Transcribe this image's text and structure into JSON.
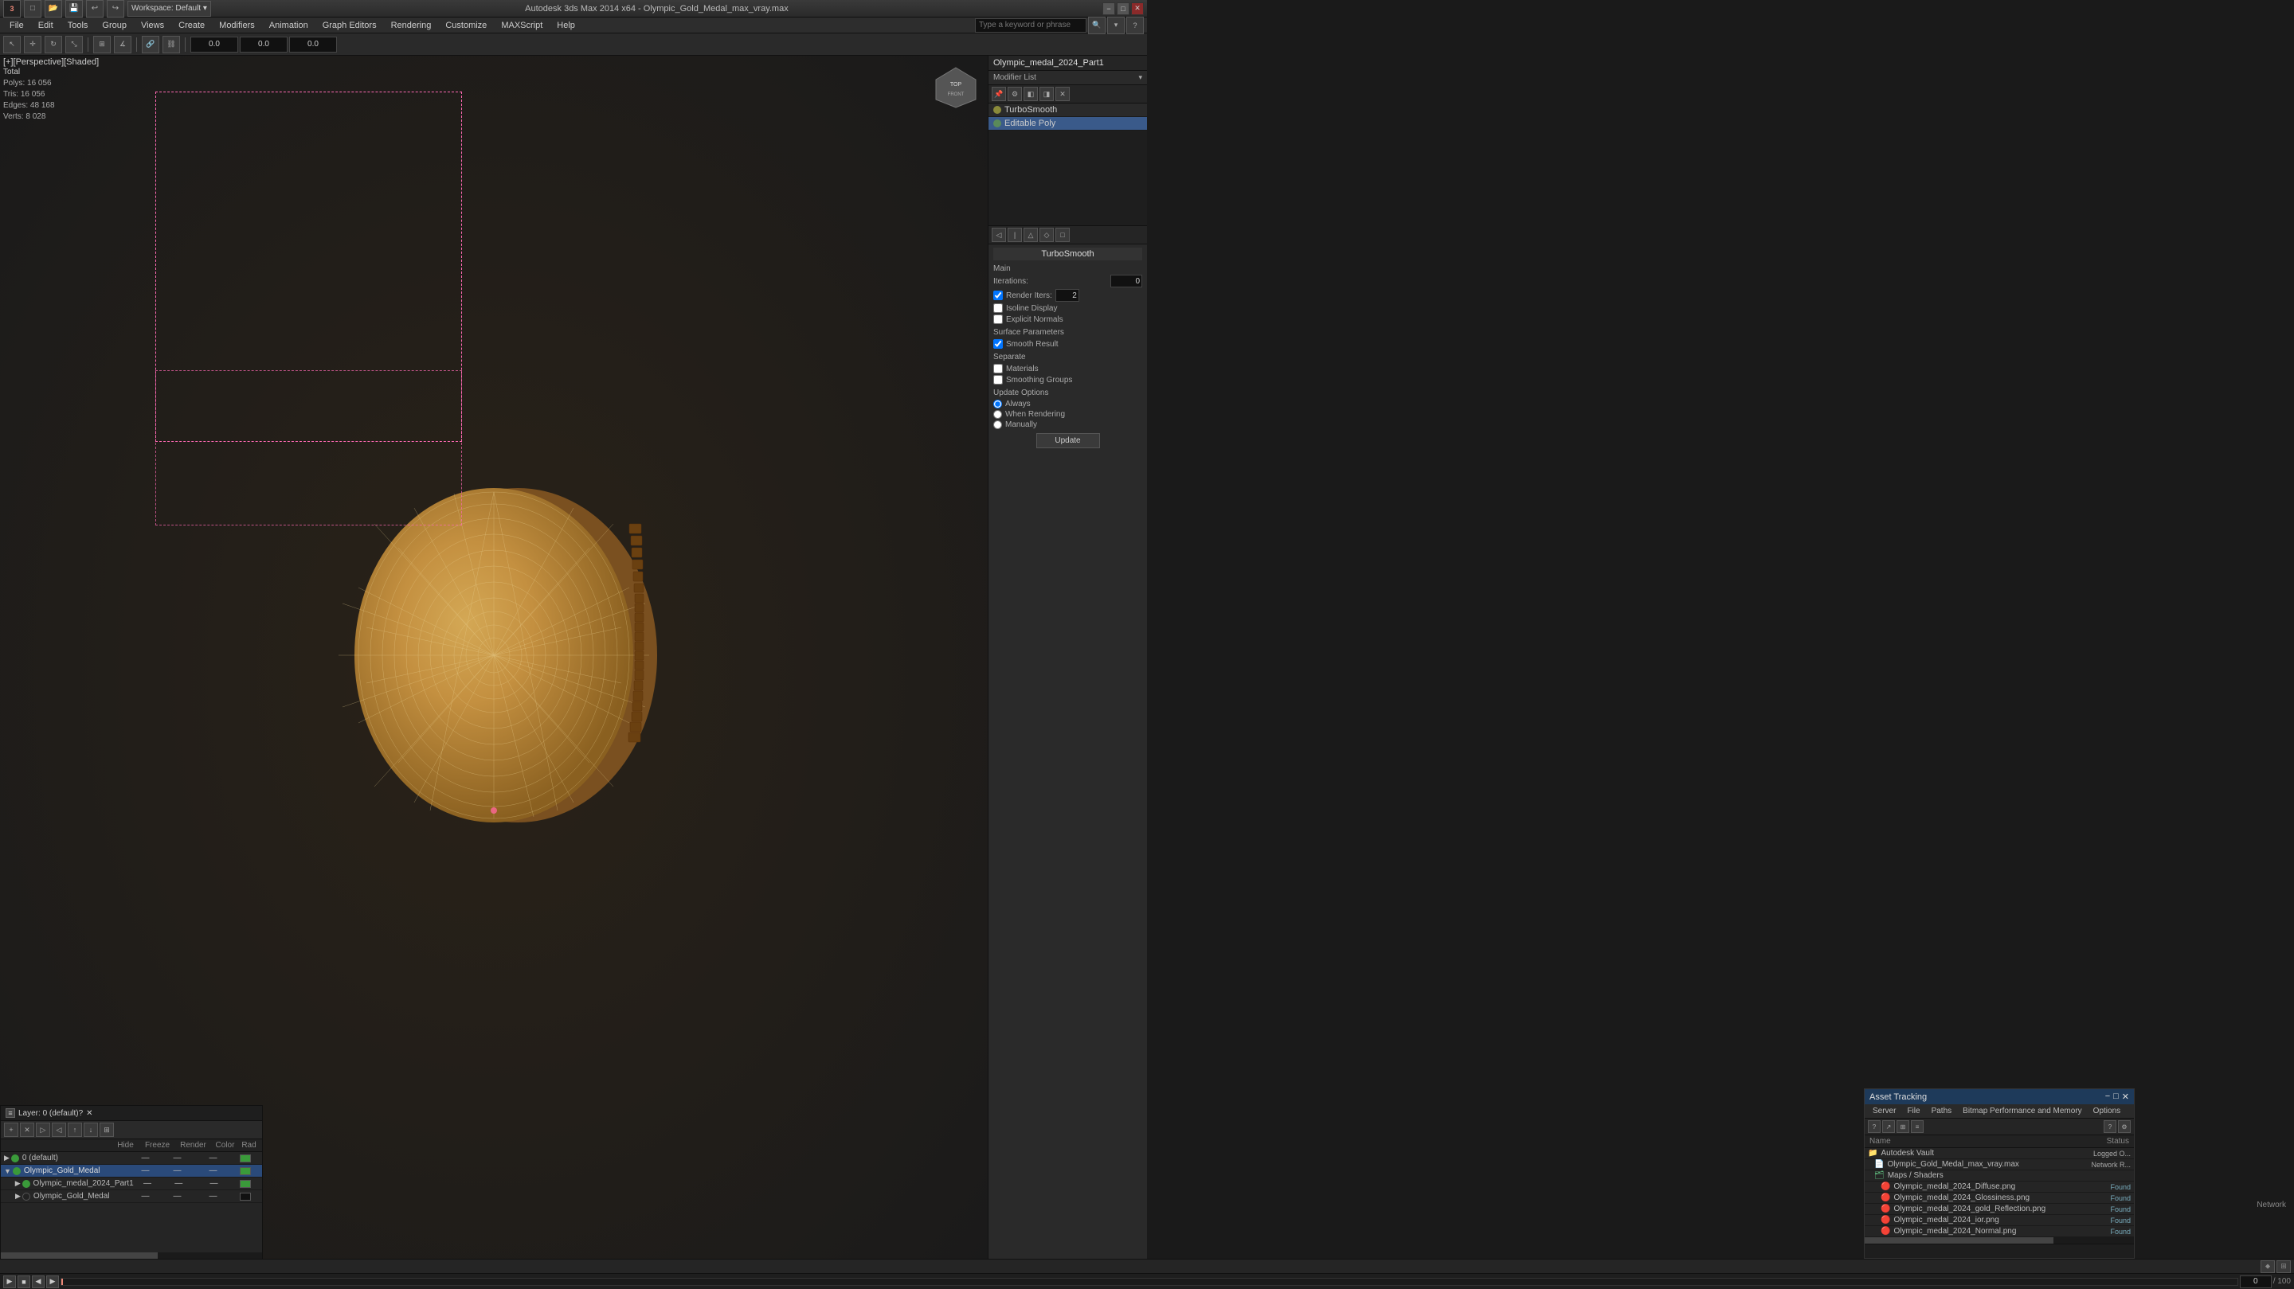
{
  "titlebar": {
    "title": "Autodesk 3ds Max 2014 x64 - Olympic_Gold_Medal_max_vray.max",
    "min_label": "−",
    "max_label": "□",
    "close_label": "✕",
    "logo": "3ds"
  },
  "menubar": {
    "items": [
      "File",
      "Edit",
      "Tools",
      "Group",
      "Views",
      "Create",
      "Modifiers",
      "Animation",
      "Graph Editors",
      "Rendering",
      "Customize",
      "MAXScript",
      "Help"
    ]
  },
  "viewport": {
    "label": "[+][Perspective][Shaded]",
    "stats": {
      "polys_label": "Polys:",
      "polys_value": "16 056",
      "tris_label": "Tris:",
      "tris_value": "16 056",
      "edges_label": "Edges:",
      "edges_value": "48 168",
      "verts_label": "Verts:",
      "verts_value": "8 028",
      "total_label": "Total"
    }
  },
  "right_panel": {
    "object_name": "Olympic_medal_2024_Part1",
    "modifier_list_label": "Modifier List",
    "modifiers": [
      {
        "name": "TurboSmooth",
        "active": false
      },
      {
        "name": "Editable Poly",
        "active": true
      }
    ],
    "turbosmooth": {
      "title": "TurboSmooth",
      "main_label": "Main",
      "iterations_label": "Iterations:",
      "iterations_value": "0",
      "render_iters_label": "Render Iters:",
      "render_iters_value": "2",
      "isoline_display_label": "Isoline Display",
      "explicit_normals_label": "Explicit Normals",
      "surface_params_label": "Surface Parameters",
      "smooth_result_label": "Smooth Result",
      "separate_label": "Separate",
      "materials_label": "Materials",
      "smoothing_groups_label": "Smoothing Groups",
      "update_options_label": "Update Options",
      "always_label": "Always",
      "when_rendering_label": "When Rendering",
      "manually_label": "Manually",
      "update_btn_label": "Update"
    }
  },
  "layer_panel": {
    "title": "Layer: 0 (default)",
    "close_label": "✕",
    "help_label": "?",
    "cols": [
      "",
      "Hide",
      "Freeze",
      "Render",
      "Color",
      "Rad"
    ],
    "layers": [
      {
        "name": "0 (default)",
        "indent": 0,
        "active": false,
        "color": "#3a9a3a"
      },
      {
        "name": "Olympic_Gold_Medal",
        "indent": 0,
        "active": true,
        "color": "#3a9a3a"
      },
      {
        "name": "Olympic_medal_2024_Part1",
        "indent": 1,
        "active": false,
        "color": "#3a9a3a"
      },
      {
        "name": "Olympic_Gold_Medal",
        "indent": 1,
        "active": false,
        "color": "#111"
      }
    ]
  },
  "asset_panel": {
    "title": "Asset Tracking",
    "menu": [
      "Server",
      "File",
      "Paths",
      "Bitmap Performance and Memory",
      "Options"
    ],
    "cols": [
      "Name",
      "Status"
    ],
    "rows": [
      {
        "name": "Autodesk Vault",
        "indent": 0,
        "icon": "folder",
        "status": "Logged O...",
        "status_type": "network"
      },
      {
        "name": "Olympic_Gold_Medal_max_vray.max",
        "indent": 1,
        "icon": "file",
        "status": "Network R...",
        "status_type": "network"
      },
      {
        "name": "Maps / Shaders",
        "indent": 1,
        "icon": "folder",
        "status": "",
        "status_type": ""
      },
      {
        "name": "Olympic_medal_2024_Diffuse.png",
        "indent": 2,
        "icon": "error",
        "status": "Found",
        "status_type": "found"
      },
      {
        "name": "Olympic_medal_2024_Glossiness.png",
        "indent": 2,
        "icon": "error",
        "status": "Found",
        "status_type": "found"
      },
      {
        "name": "Olympic_medal_2024_gold_Reflection.png",
        "indent": 2,
        "icon": "error",
        "status": "Found",
        "status_type": "found"
      },
      {
        "name": "Olympic_medal_2024_ior.png",
        "indent": 2,
        "icon": "error",
        "status": "Found",
        "status_type": "found"
      },
      {
        "name": "Olympic_medal_2024_Normal.png",
        "indent": 2,
        "icon": "error",
        "status": "Found",
        "status_type": "found"
      }
    ]
  },
  "status_bar": {
    "text": ""
  },
  "network_text": "Network"
}
